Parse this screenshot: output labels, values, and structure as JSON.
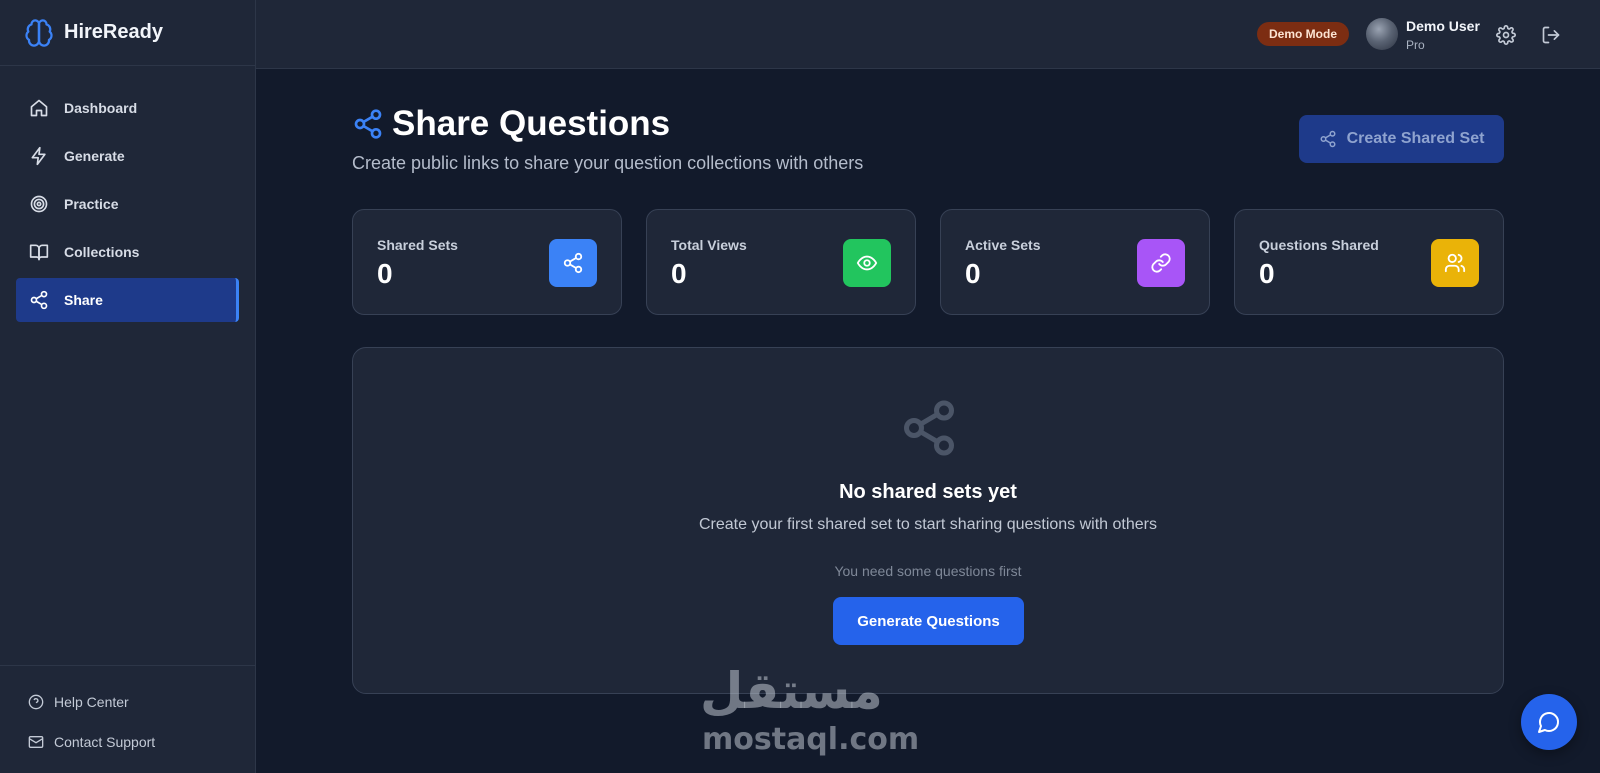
{
  "app": {
    "name": "HireReady"
  },
  "sidebar": {
    "items": [
      {
        "label": "Dashboard",
        "icon": "home-icon"
      },
      {
        "label": "Generate",
        "icon": "lightning-icon"
      },
      {
        "label": "Practice",
        "icon": "target-icon"
      },
      {
        "label": "Collections",
        "icon": "book-icon"
      },
      {
        "label": "Share",
        "icon": "share-icon",
        "active": true
      }
    ],
    "footer": [
      {
        "label": "Help Center",
        "icon": "help-circle-icon"
      },
      {
        "label": "Contact Support",
        "icon": "mail-icon"
      }
    ]
  },
  "topbar": {
    "badge": "Demo Mode",
    "user_name": "Demo User",
    "user_plan": "Pro"
  },
  "page": {
    "title": "Share Questions",
    "subtitle": "Create public links to share your question collections with others",
    "create_button": "Create Shared Set"
  },
  "stats": [
    {
      "label": "Shared Sets",
      "value": "0",
      "icon": "share-icon",
      "color": "#3b82f6"
    },
    {
      "label": "Total Views",
      "value": "0",
      "icon": "eye-icon",
      "color": "#22c55e"
    },
    {
      "label": "Active Sets",
      "value": "0",
      "icon": "link-icon",
      "color": "#a855f7"
    },
    {
      "label": "Questions Shared",
      "value": "0",
      "icon": "users-icon",
      "color": "#eab308"
    }
  ],
  "empty_state": {
    "title": "No shared sets yet",
    "text": "Create your first shared set to start sharing questions with others",
    "hint": "You need some questions first",
    "button": "Generate Questions"
  },
  "watermark": {
    "arabic": "مستقل",
    "latin": "mostaql.com"
  },
  "colors": {
    "accent": "#2563eb",
    "active_nav": "#1e3a8a",
    "badge": "#7c2d12"
  }
}
